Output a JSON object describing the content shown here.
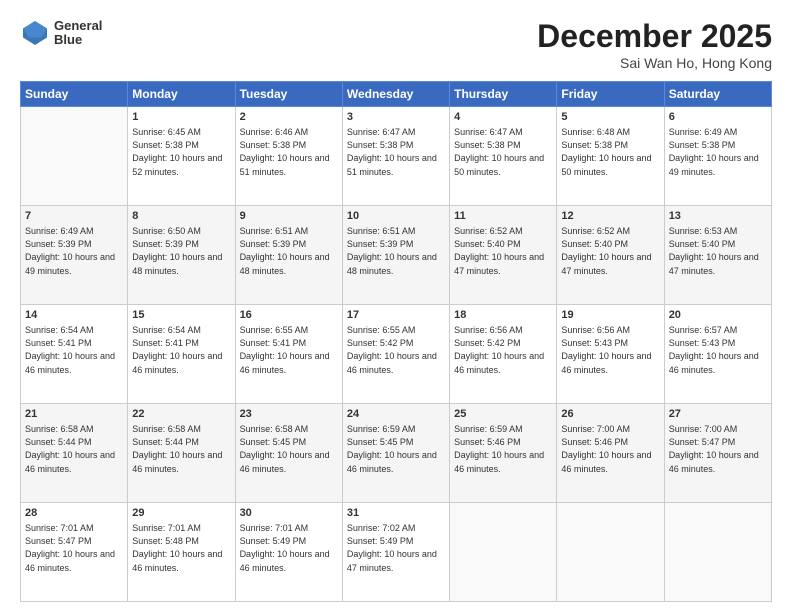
{
  "header": {
    "logo_line1": "General",
    "logo_line2": "Blue",
    "title": "December 2025",
    "subtitle": "Sai Wan Ho, Hong Kong"
  },
  "days_of_week": [
    "Sunday",
    "Monday",
    "Tuesday",
    "Wednesday",
    "Thursday",
    "Friday",
    "Saturday"
  ],
  "weeks": [
    [
      {
        "num": "",
        "sunrise": "",
        "sunset": "",
        "daylight": ""
      },
      {
        "num": "1",
        "sunrise": "Sunrise: 6:45 AM",
        "sunset": "Sunset: 5:38 PM",
        "daylight": "Daylight: 10 hours and 52 minutes."
      },
      {
        "num": "2",
        "sunrise": "Sunrise: 6:46 AM",
        "sunset": "Sunset: 5:38 PM",
        "daylight": "Daylight: 10 hours and 51 minutes."
      },
      {
        "num": "3",
        "sunrise": "Sunrise: 6:47 AM",
        "sunset": "Sunset: 5:38 PM",
        "daylight": "Daylight: 10 hours and 51 minutes."
      },
      {
        "num": "4",
        "sunrise": "Sunrise: 6:47 AM",
        "sunset": "Sunset: 5:38 PM",
        "daylight": "Daylight: 10 hours and 50 minutes."
      },
      {
        "num": "5",
        "sunrise": "Sunrise: 6:48 AM",
        "sunset": "Sunset: 5:38 PM",
        "daylight": "Daylight: 10 hours and 50 minutes."
      },
      {
        "num": "6",
        "sunrise": "Sunrise: 6:49 AM",
        "sunset": "Sunset: 5:38 PM",
        "daylight": "Daylight: 10 hours and 49 minutes."
      }
    ],
    [
      {
        "num": "7",
        "sunrise": "Sunrise: 6:49 AM",
        "sunset": "Sunset: 5:39 PM",
        "daylight": "Daylight: 10 hours and 49 minutes."
      },
      {
        "num": "8",
        "sunrise": "Sunrise: 6:50 AM",
        "sunset": "Sunset: 5:39 PM",
        "daylight": "Daylight: 10 hours and 48 minutes."
      },
      {
        "num": "9",
        "sunrise": "Sunrise: 6:51 AM",
        "sunset": "Sunset: 5:39 PM",
        "daylight": "Daylight: 10 hours and 48 minutes."
      },
      {
        "num": "10",
        "sunrise": "Sunrise: 6:51 AM",
        "sunset": "Sunset: 5:39 PM",
        "daylight": "Daylight: 10 hours and 48 minutes."
      },
      {
        "num": "11",
        "sunrise": "Sunrise: 6:52 AM",
        "sunset": "Sunset: 5:40 PM",
        "daylight": "Daylight: 10 hours and 47 minutes."
      },
      {
        "num": "12",
        "sunrise": "Sunrise: 6:52 AM",
        "sunset": "Sunset: 5:40 PM",
        "daylight": "Daylight: 10 hours and 47 minutes."
      },
      {
        "num": "13",
        "sunrise": "Sunrise: 6:53 AM",
        "sunset": "Sunset: 5:40 PM",
        "daylight": "Daylight: 10 hours and 47 minutes."
      }
    ],
    [
      {
        "num": "14",
        "sunrise": "Sunrise: 6:54 AM",
        "sunset": "Sunset: 5:41 PM",
        "daylight": "Daylight: 10 hours and 46 minutes."
      },
      {
        "num": "15",
        "sunrise": "Sunrise: 6:54 AM",
        "sunset": "Sunset: 5:41 PM",
        "daylight": "Daylight: 10 hours and 46 minutes."
      },
      {
        "num": "16",
        "sunrise": "Sunrise: 6:55 AM",
        "sunset": "Sunset: 5:41 PM",
        "daylight": "Daylight: 10 hours and 46 minutes."
      },
      {
        "num": "17",
        "sunrise": "Sunrise: 6:55 AM",
        "sunset": "Sunset: 5:42 PM",
        "daylight": "Daylight: 10 hours and 46 minutes."
      },
      {
        "num": "18",
        "sunrise": "Sunrise: 6:56 AM",
        "sunset": "Sunset: 5:42 PM",
        "daylight": "Daylight: 10 hours and 46 minutes."
      },
      {
        "num": "19",
        "sunrise": "Sunrise: 6:56 AM",
        "sunset": "Sunset: 5:43 PM",
        "daylight": "Daylight: 10 hours and 46 minutes."
      },
      {
        "num": "20",
        "sunrise": "Sunrise: 6:57 AM",
        "sunset": "Sunset: 5:43 PM",
        "daylight": "Daylight: 10 hours and 46 minutes."
      }
    ],
    [
      {
        "num": "21",
        "sunrise": "Sunrise: 6:58 AM",
        "sunset": "Sunset: 5:44 PM",
        "daylight": "Daylight: 10 hours and 46 minutes."
      },
      {
        "num": "22",
        "sunrise": "Sunrise: 6:58 AM",
        "sunset": "Sunset: 5:44 PM",
        "daylight": "Daylight: 10 hours and 46 minutes."
      },
      {
        "num": "23",
        "sunrise": "Sunrise: 6:58 AM",
        "sunset": "Sunset: 5:45 PM",
        "daylight": "Daylight: 10 hours and 46 minutes."
      },
      {
        "num": "24",
        "sunrise": "Sunrise: 6:59 AM",
        "sunset": "Sunset: 5:45 PM",
        "daylight": "Daylight: 10 hours and 46 minutes."
      },
      {
        "num": "25",
        "sunrise": "Sunrise: 6:59 AM",
        "sunset": "Sunset: 5:46 PM",
        "daylight": "Daylight: 10 hours and 46 minutes."
      },
      {
        "num": "26",
        "sunrise": "Sunrise: 7:00 AM",
        "sunset": "Sunset: 5:46 PM",
        "daylight": "Daylight: 10 hours and 46 minutes."
      },
      {
        "num": "27",
        "sunrise": "Sunrise: 7:00 AM",
        "sunset": "Sunset: 5:47 PM",
        "daylight": "Daylight: 10 hours and 46 minutes."
      }
    ],
    [
      {
        "num": "28",
        "sunrise": "Sunrise: 7:01 AM",
        "sunset": "Sunset: 5:47 PM",
        "daylight": "Daylight: 10 hours and 46 minutes."
      },
      {
        "num": "29",
        "sunrise": "Sunrise: 7:01 AM",
        "sunset": "Sunset: 5:48 PM",
        "daylight": "Daylight: 10 hours and 46 minutes."
      },
      {
        "num": "30",
        "sunrise": "Sunrise: 7:01 AM",
        "sunset": "Sunset: 5:49 PM",
        "daylight": "Daylight: 10 hours and 46 minutes."
      },
      {
        "num": "31",
        "sunrise": "Sunrise: 7:02 AM",
        "sunset": "Sunset: 5:49 PM",
        "daylight": "Daylight: 10 hours and 47 minutes."
      },
      {
        "num": "",
        "sunrise": "",
        "sunset": "",
        "daylight": ""
      },
      {
        "num": "",
        "sunrise": "",
        "sunset": "",
        "daylight": ""
      },
      {
        "num": "",
        "sunrise": "",
        "sunset": "",
        "daylight": ""
      }
    ]
  ]
}
